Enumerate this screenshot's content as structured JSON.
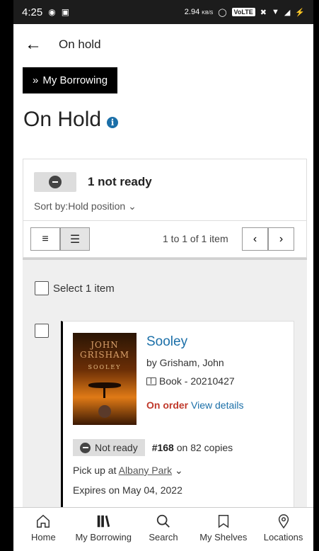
{
  "status_bar": {
    "time": "4:25",
    "network_speed": "2.94",
    "network_unit": "KB/S",
    "volte": "VoLTE"
  },
  "app_bar": {
    "title": "On hold"
  },
  "breadcrumb": {
    "label": "My Borrowing"
  },
  "page": {
    "title": "On Hold"
  },
  "summary": {
    "not_ready": "1 not ready"
  },
  "sort": {
    "label": "Sort by:",
    "value": "Hold position"
  },
  "pagination": {
    "text": "1 to 1 of 1 item"
  },
  "select_all": {
    "label": "Select 1 item"
  },
  "item": {
    "cover_author_first": "JOHN",
    "cover_author_last": "GRISHAM",
    "cover_title": "SOOLEY",
    "title": "Sooley",
    "author": "by Grisham, John",
    "format": "Book - 20210427",
    "status": "On order",
    "details_link": "View details",
    "hold_status": "Not ready",
    "queue_position": "#168",
    "copies": "on 82 copies",
    "pickup_label": "Pick up at",
    "pickup_location": "Albany Park",
    "expires": "Expires on May 04, 2022"
  },
  "bottom_nav": [
    {
      "label": "Home"
    },
    {
      "label": "My Borrowing"
    },
    {
      "label": "Search"
    },
    {
      "label": "My Shelves"
    },
    {
      "label": "Locations"
    }
  ],
  "colors": {
    "link": "#1b6fa8",
    "on_order": "#c0392b",
    "status_bar": "#1c1c1c"
  }
}
